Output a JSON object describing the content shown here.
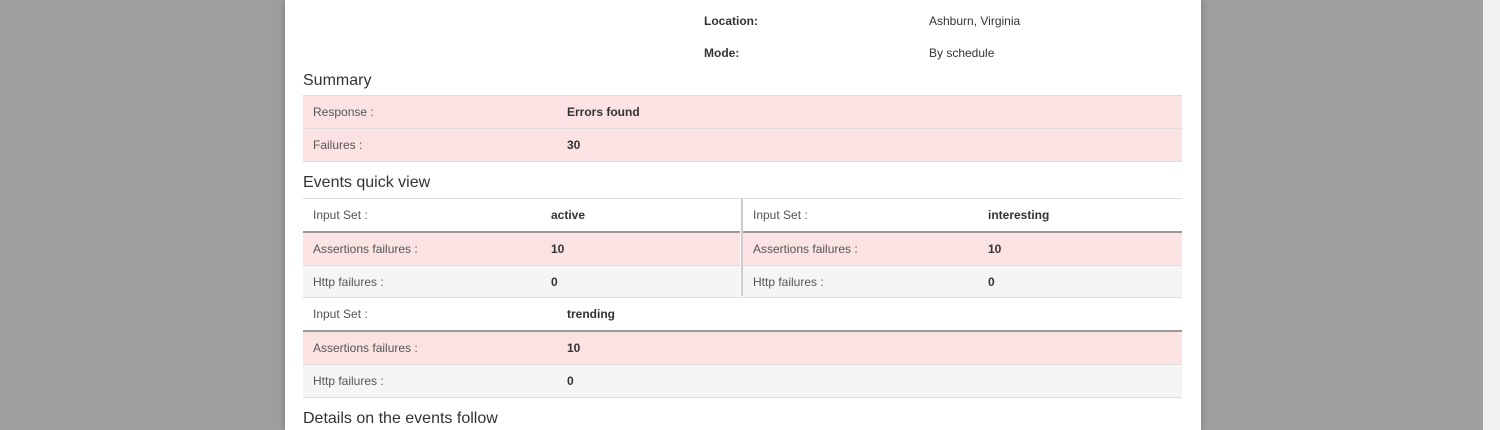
{
  "meta": {
    "location_label": "Location:",
    "location_value": "Ashburn, Virginia",
    "mode_label": "Mode:",
    "mode_value": "By schedule"
  },
  "summary": {
    "title": "Summary",
    "rows": [
      {
        "label": "Response :",
        "value": "Errors found"
      },
      {
        "label": "Failures :",
        "value": "30"
      }
    ]
  },
  "events": {
    "title": "Events quick view",
    "sets": [
      {
        "input_label": "Input Set :",
        "input_value": "active",
        "assert_label": "Assertions failures :",
        "assert_value": "10",
        "http_label": "Http failures :",
        "http_value": "0"
      },
      {
        "input_label": "Input Set :",
        "input_value": "interesting",
        "assert_label": "Assertions failures :",
        "assert_value": "10",
        "http_label": "Http failures :",
        "http_value": "0"
      },
      {
        "input_label": "Input Set :",
        "input_value": "trending",
        "assert_label": "Assertions failures :",
        "assert_value": "10",
        "http_label": "Http failures :",
        "http_value": "0"
      }
    ]
  },
  "details": {
    "title": "Details on the events follow"
  },
  "colors": {
    "danger_row": "#fbe3e3",
    "stripe_row": "#f5f5f5",
    "backdrop": "#9e9e9e"
  }
}
